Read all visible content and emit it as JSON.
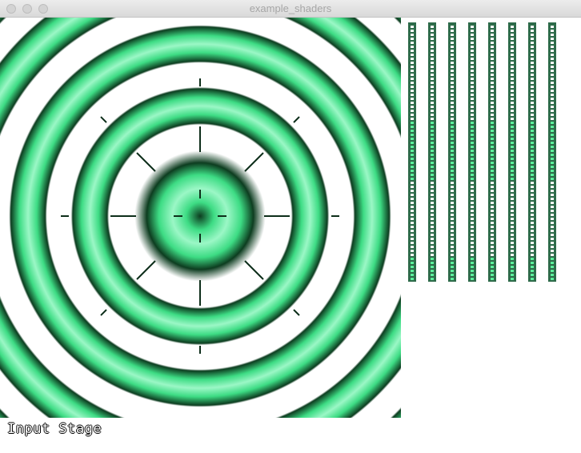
{
  "window": {
    "title": "example_shaders",
    "buttons": [
      "close-button",
      "minimize-button",
      "zoom-button"
    ]
  },
  "viewport": {
    "pattern": "concentric-rings",
    "ring_color": "#3ddc84",
    "ring_shadow": "#0c3a20",
    "background": "#ffffff"
  },
  "stage_strips": {
    "count": 8,
    "strip_color": "#2e6b4a",
    "dot_color": "#ffffff",
    "accent": "#5cf09c"
  },
  "status": {
    "label": "Input Stage"
  }
}
